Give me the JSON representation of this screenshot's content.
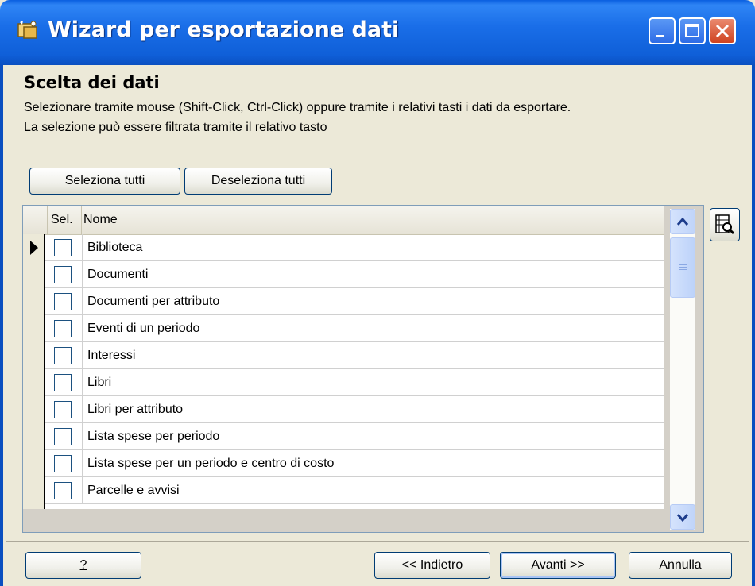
{
  "window": {
    "title": "Wizard per esportazione dati"
  },
  "header": {
    "title": "Scelta dei dati",
    "line1": "Selezionare tramite mouse (Shift-Click, Ctrl-Click) oppure tramite i  relativi tasti i dati da esportare.",
    "line2": "La selezione può essere filtrata tramite il relativo tasto"
  },
  "toolbar": {
    "select_all": "Seleziona tutti",
    "deselect_all": "Deseleziona tutti"
  },
  "grid": {
    "columns": {
      "sel": "Sel.",
      "name": "Nome"
    },
    "rows": [
      {
        "name": "Biblioteca",
        "checked": false,
        "current": true
      },
      {
        "name": "Documenti",
        "checked": false
      },
      {
        "name": "Documenti per attributo",
        "checked": false
      },
      {
        "name": "Eventi di un periodo",
        "checked": false
      },
      {
        "name": "Interessi",
        "checked": false
      },
      {
        "name": "Libri",
        "checked": false
      },
      {
        "name": "Libri per attributo",
        "checked": false
      },
      {
        "name": "Lista spese per periodo",
        "checked": false
      },
      {
        "name": "Lista spese per un periodo e centro di costo",
        "checked": false
      },
      {
        "name": "Parcelle e avvisi",
        "checked": false
      }
    ]
  },
  "footer": {
    "help": "?",
    "back": "<< Indietro",
    "next": "Avanti >>",
    "cancel": "Annulla"
  },
  "icons": {
    "title": "wizard-icon",
    "filter": "filter-icon"
  }
}
